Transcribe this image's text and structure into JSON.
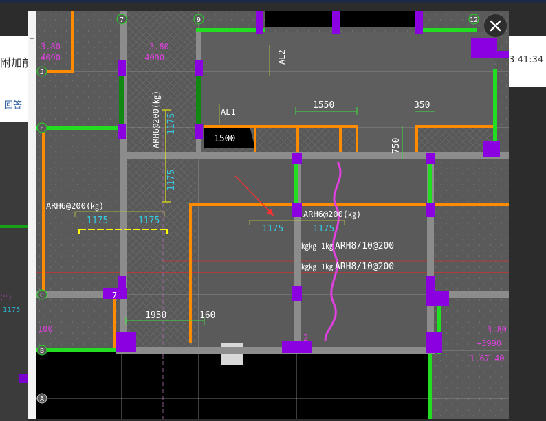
{
  "background_page": {
    "title_fragment": "附加前",
    "answer_link": "回答",
    "time_fragment": "3:41:34",
    "left_cad_text_1": "(ᵏᵇ)",
    "left_cad_text_2": "1175"
  },
  "modal": {
    "close_icon": "close-x-icon",
    "drawing": {
      "grid_axes": [
        "7",
        "9",
        "12",
        "J",
        "F",
        "C",
        "B",
        "A"
      ],
      "dims": {
        "d1550": "1550",
        "d350": "350",
        "d1500": "1500",
        "d750": "750",
        "d1175a": "1175",
        "d1175b": "1175",
        "d1175c": "1175",
        "d1175d": "1175",
        "d1175v1": "1175",
        "d1175v2": "1175",
        "d1950": "1950",
        "d160": "160"
      },
      "labels": {
        "al1": "AL1",
        "al2": "AL2",
        "arh_left": "ARH6@200(㎏)",
        "arh_vert": "ARH6@200(㎏)",
        "arh_center": "ARH6@200(㎏)",
        "arh8_a": "ARH8/10@200",
        "arh8_b": "ARH8/10@200",
        "arh8_prefix_a": "㎏㎏ 1㎏",
        "arh8_prefix_b": "㎏㎏ 1㎏",
        "mag_tl_1": "3.80",
        "mag_tl_2": "4090",
        "mag_tc_1": "3.80",
        "mag_tc_2": "+4090",
        "mag_br_1": "3.80",
        "mag_br_2": "+3990",
        "mag_br_3": "1.67+40",
        "mag_small_c": "2",
        "mag_left_c": "100",
        "mark_7": "7"
      }
    }
  },
  "colors": {
    "cad_bg": "#5a5a5a",
    "wall_orange": "#ff8c00",
    "wall_green": "#22dd22",
    "column_purple": "#8a00e0",
    "dim_cyan": "#35c8e0",
    "dim_green": "#3fe03f",
    "text_magenta": "#e040e0",
    "text_yellow": "#ffff00"
  }
}
